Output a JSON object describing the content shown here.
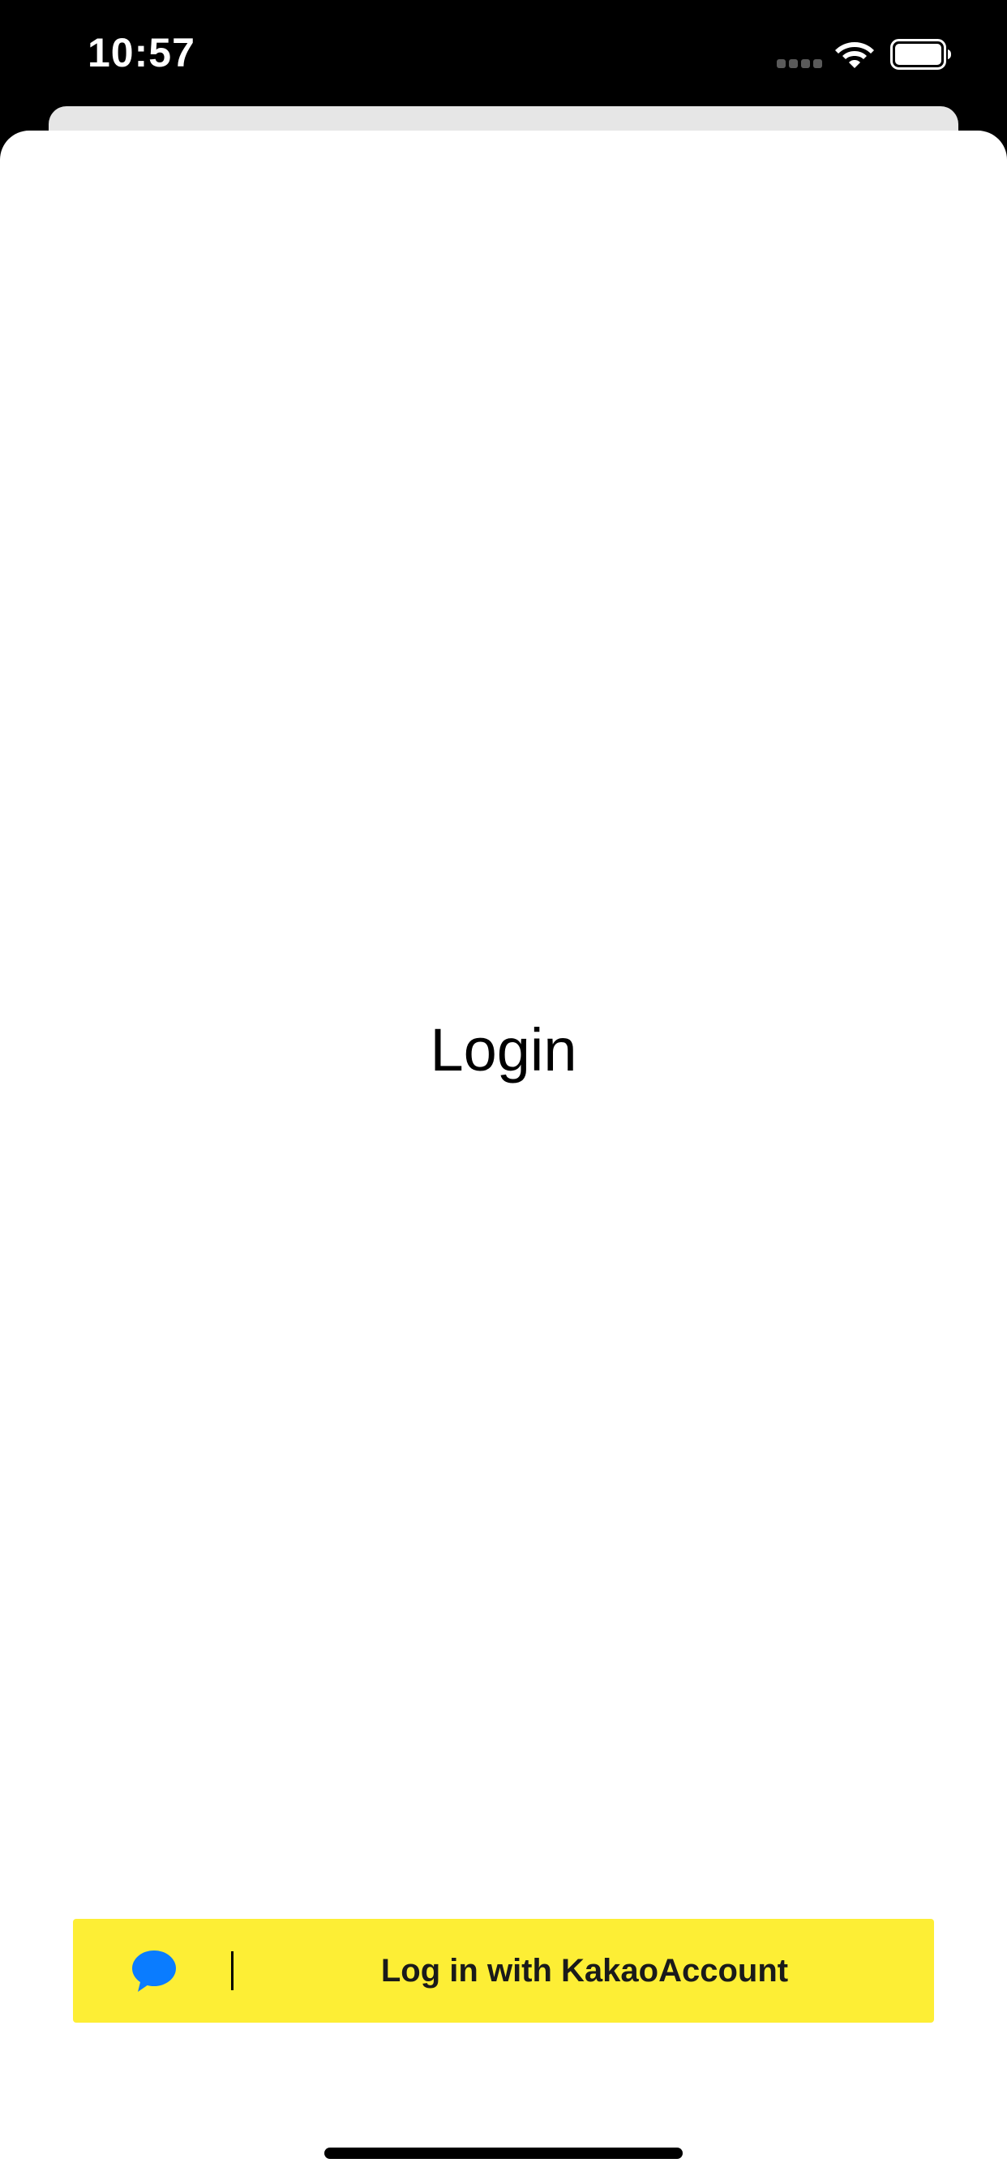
{
  "status_bar": {
    "time": "10:57"
  },
  "main": {
    "title": "Login"
  },
  "kakao_button": {
    "label": "Log in with KakaoAccount",
    "icon": "speech-bubble-icon",
    "background_color": "#fdee35",
    "icon_color": "#0a7cff"
  }
}
